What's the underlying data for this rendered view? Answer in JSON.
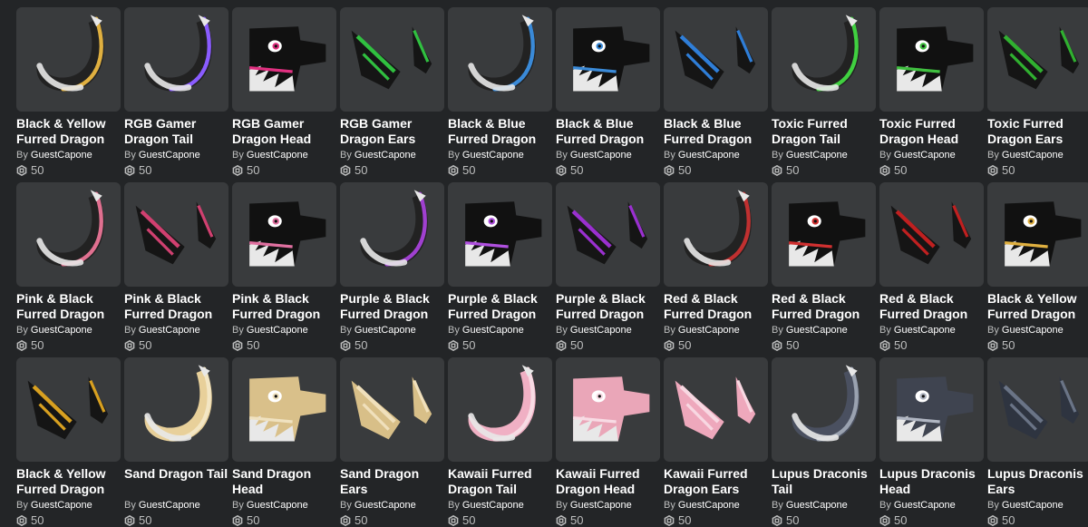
{
  "catalog": {
    "by_prefix": "By",
    "items": [
      {
        "name": "Black & Yellow Furred Dragon",
        "creator": "GuestCapone",
        "price": "50",
        "kind": "tail",
        "icon": "dragon-tail-icon",
        "primary": "#222222",
        "accent": "#e0b040"
      },
      {
        "name": "RGB Gamer Dragon Tail",
        "creator": "GuestCapone",
        "price": "50",
        "kind": "tail",
        "icon": "dragon-tail-icon",
        "primary": "#222222",
        "accent": "#8a5cff"
      },
      {
        "name": "RGB Gamer Dragon Head",
        "creator": "GuestCapone",
        "price": "50",
        "kind": "head",
        "icon": "dragon-head-icon",
        "primary": "#111111",
        "accent": "#e03080"
      },
      {
        "name": "RGB Gamer Dragon Ears",
        "creator": "GuestCapone",
        "price": "50",
        "kind": "ears",
        "icon": "dragon-ears-icon",
        "primary": "#151515",
        "accent": "#30c040"
      },
      {
        "name": "Black & Blue Furred Dragon",
        "creator": "GuestCapone",
        "price": "50",
        "kind": "tail",
        "icon": "dragon-tail-icon",
        "primary": "#222222",
        "accent": "#3a8ad8"
      },
      {
        "name": "Black & Blue Furred Dragon",
        "creator": "GuestCapone",
        "price": "50",
        "kind": "head",
        "icon": "dragon-head-icon",
        "primary": "#111111",
        "accent": "#3a8ad8"
      },
      {
        "name": "Black & Blue Furred Dragon",
        "creator": "GuestCapone",
        "price": "50",
        "kind": "ears",
        "icon": "dragon-ears-icon",
        "primary": "#151515",
        "accent": "#2f7ed8"
      },
      {
        "name": "Toxic Furred Dragon Tail",
        "creator": "GuestCapone",
        "price": "50",
        "kind": "tail",
        "icon": "dragon-tail-icon",
        "primary": "#222222",
        "accent": "#40d040"
      },
      {
        "name": "Toxic Furred Dragon Head",
        "creator": "GuestCapone",
        "price": "50",
        "kind": "head",
        "icon": "dragon-head-icon",
        "primary": "#111111",
        "accent": "#40c040"
      },
      {
        "name": "Toxic Furred Dragon Ears",
        "creator": "GuestCapone",
        "price": "50",
        "kind": "ears",
        "icon": "dragon-ears-icon",
        "primary": "#151515",
        "accent": "#30b030"
      },
      {
        "name": "Pink & Black Furred Dragon",
        "creator": "GuestCapone",
        "price": "50",
        "kind": "tail",
        "icon": "dragon-tail-icon",
        "primary": "#222222",
        "accent": "#e07090"
      },
      {
        "name": "Pink & Black Furred Dragon",
        "creator": "GuestCapone",
        "price": "50",
        "kind": "ears",
        "icon": "dragon-ears-icon",
        "primary": "#151515",
        "accent": "#d04070"
      },
      {
        "name": "Pink & Black Furred Dragon",
        "creator": "GuestCapone",
        "price": "50",
        "kind": "head",
        "icon": "dragon-head-icon",
        "primary": "#111111",
        "accent": "#e070a0"
      },
      {
        "name": "Purple & Black Furred Dragon",
        "creator": "GuestCapone",
        "price": "50",
        "kind": "tail",
        "icon": "dragon-tail-icon",
        "primary": "#222222",
        "accent": "#a040d0"
      },
      {
        "name": "Purple & Black Furred Dragon",
        "creator": "GuestCapone",
        "price": "50",
        "kind": "head",
        "icon": "dragon-head-icon",
        "primary": "#111111",
        "accent": "#b050e0"
      },
      {
        "name": "Purple & Black Furred Dragon",
        "creator": "GuestCapone",
        "price": "50",
        "kind": "ears",
        "icon": "dragon-ears-icon",
        "primary": "#151515",
        "accent": "#9a30d0"
      },
      {
        "name": "Red & Black Furred Dragon",
        "creator": "GuestCapone",
        "price": "50",
        "kind": "tail",
        "icon": "dragon-tail-icon",
        "primary": "#222222",
        "accent": "#c03030"
      },
      {
        "name": "Red & Black Furred Dragon",
        "creator": "GuestCapone",
        "price": "50",
        "kind": "head",
        "icon": "dragon-head-icon",
        "primary": "#111111",
        "accent": "#d03030"
      },
      {
        "name": "Red & Black Furred Dragon",
        "creator": "GuestCapone",
        "price": "50",
        "kind": "ears",
        "icon": "dragon-ears-icon",
        "primary": "#151515",
        "accent": "#c02020"
      },
      {
        "name": "Black & Yellow Furred Dragon",
        "creator": "GuestCapone",
        "price": "50",
        "kind": "head",
        "icon": "dragon-head-icon",
        "primary": "#111111",
        "accent": "#e0b040"
      },
      {
        "name": "Black & Yellow Furred Dragon",
        "creator": "GuestCapone",
        "price": "50",
        "kind": "ears",
        "icon": "dragon-ears-icon",
        "primary": "#151515",
        "accent": "#d8a020"
      },
      {
        "name": "Sand Dragon Tail",
        "creator": "GuestCapone",
        "price": "50",
        "kind": "tail",
        "icon": "dragon-tail-icon",
        "primary": "#e8d09a",
        "accent": "#f3e6c4"
      },
      {
        "name": "Sand Dragon Head",
        "creator": "GuestCapone",
        "price": "50",
        "kind": "head",
        "icon": "dragon-head-icon",
        "primary": "#d9c08a",
        "accent": "#f0e2c0"
      },
      {
        "name": "Sand Dragon Ears",
        "creator": "GuestCapone",
        "price": "50",
        "kind": "ears",
        "icon": "dragon-ears-icon",
        "primary": "#d8bf88",
        "accent": "#f0e0bc"
      },
      {
        "name": "Kawaii Furred Dragon Tail",
        "creator": "GuestCapone",
        "price": "50",
        "kind": "tail",
        "icon": "dragon-tail-icon",
        "primary": "#f0b0c4",
        "accent": "#f8dbe4"
      },
      {
        "name": "Kawaii Furred Dragon Head",
        "creator": "GuestCapone",
        "price": "50",
        "kind": "head",
        "icon": "dragon-head-icon",
        "primary": "#eaa6b8",
        "accent": "#f8dbe4"
      },
      {
        "name": "Kawaii Furred Dragon Ears",
        "creator": "GuestCapone",
        "price": "50",
        "kind": "ears",
        "icon": "dragon-ears-icon",
        "primary": "#eea8bc",
        "accent": "#f8d8e2"
      },
      {
        "name": "Lupus Draconis Tail",
        "creator": "GuestCapone",
        "price": "50",
        "kind": "tail",
        "icon": "dragon-tail-icon",
        "primary": "#4a5060",
        "accent": "#9aa2b0"
      },
      {
        "name": "Lupus Draconis Head",
        "creator": "GuestCapone",
        "price": "50",
        "kind": "head",
        "icon": "dragon-head-icon",
        "primary": "#3f4450",
        "accent": "#b0b6c2"
      },
      {
        "name": "Lupus Draconis Ears",
        "creator": "GuestCapone",
        "price": "50",
        "kind": "ears",
        "icon": "dragon-ears-icon",
        "primary": "#2e3440",
        "accent": "#6a7486"
      }
    ]
  }
}
